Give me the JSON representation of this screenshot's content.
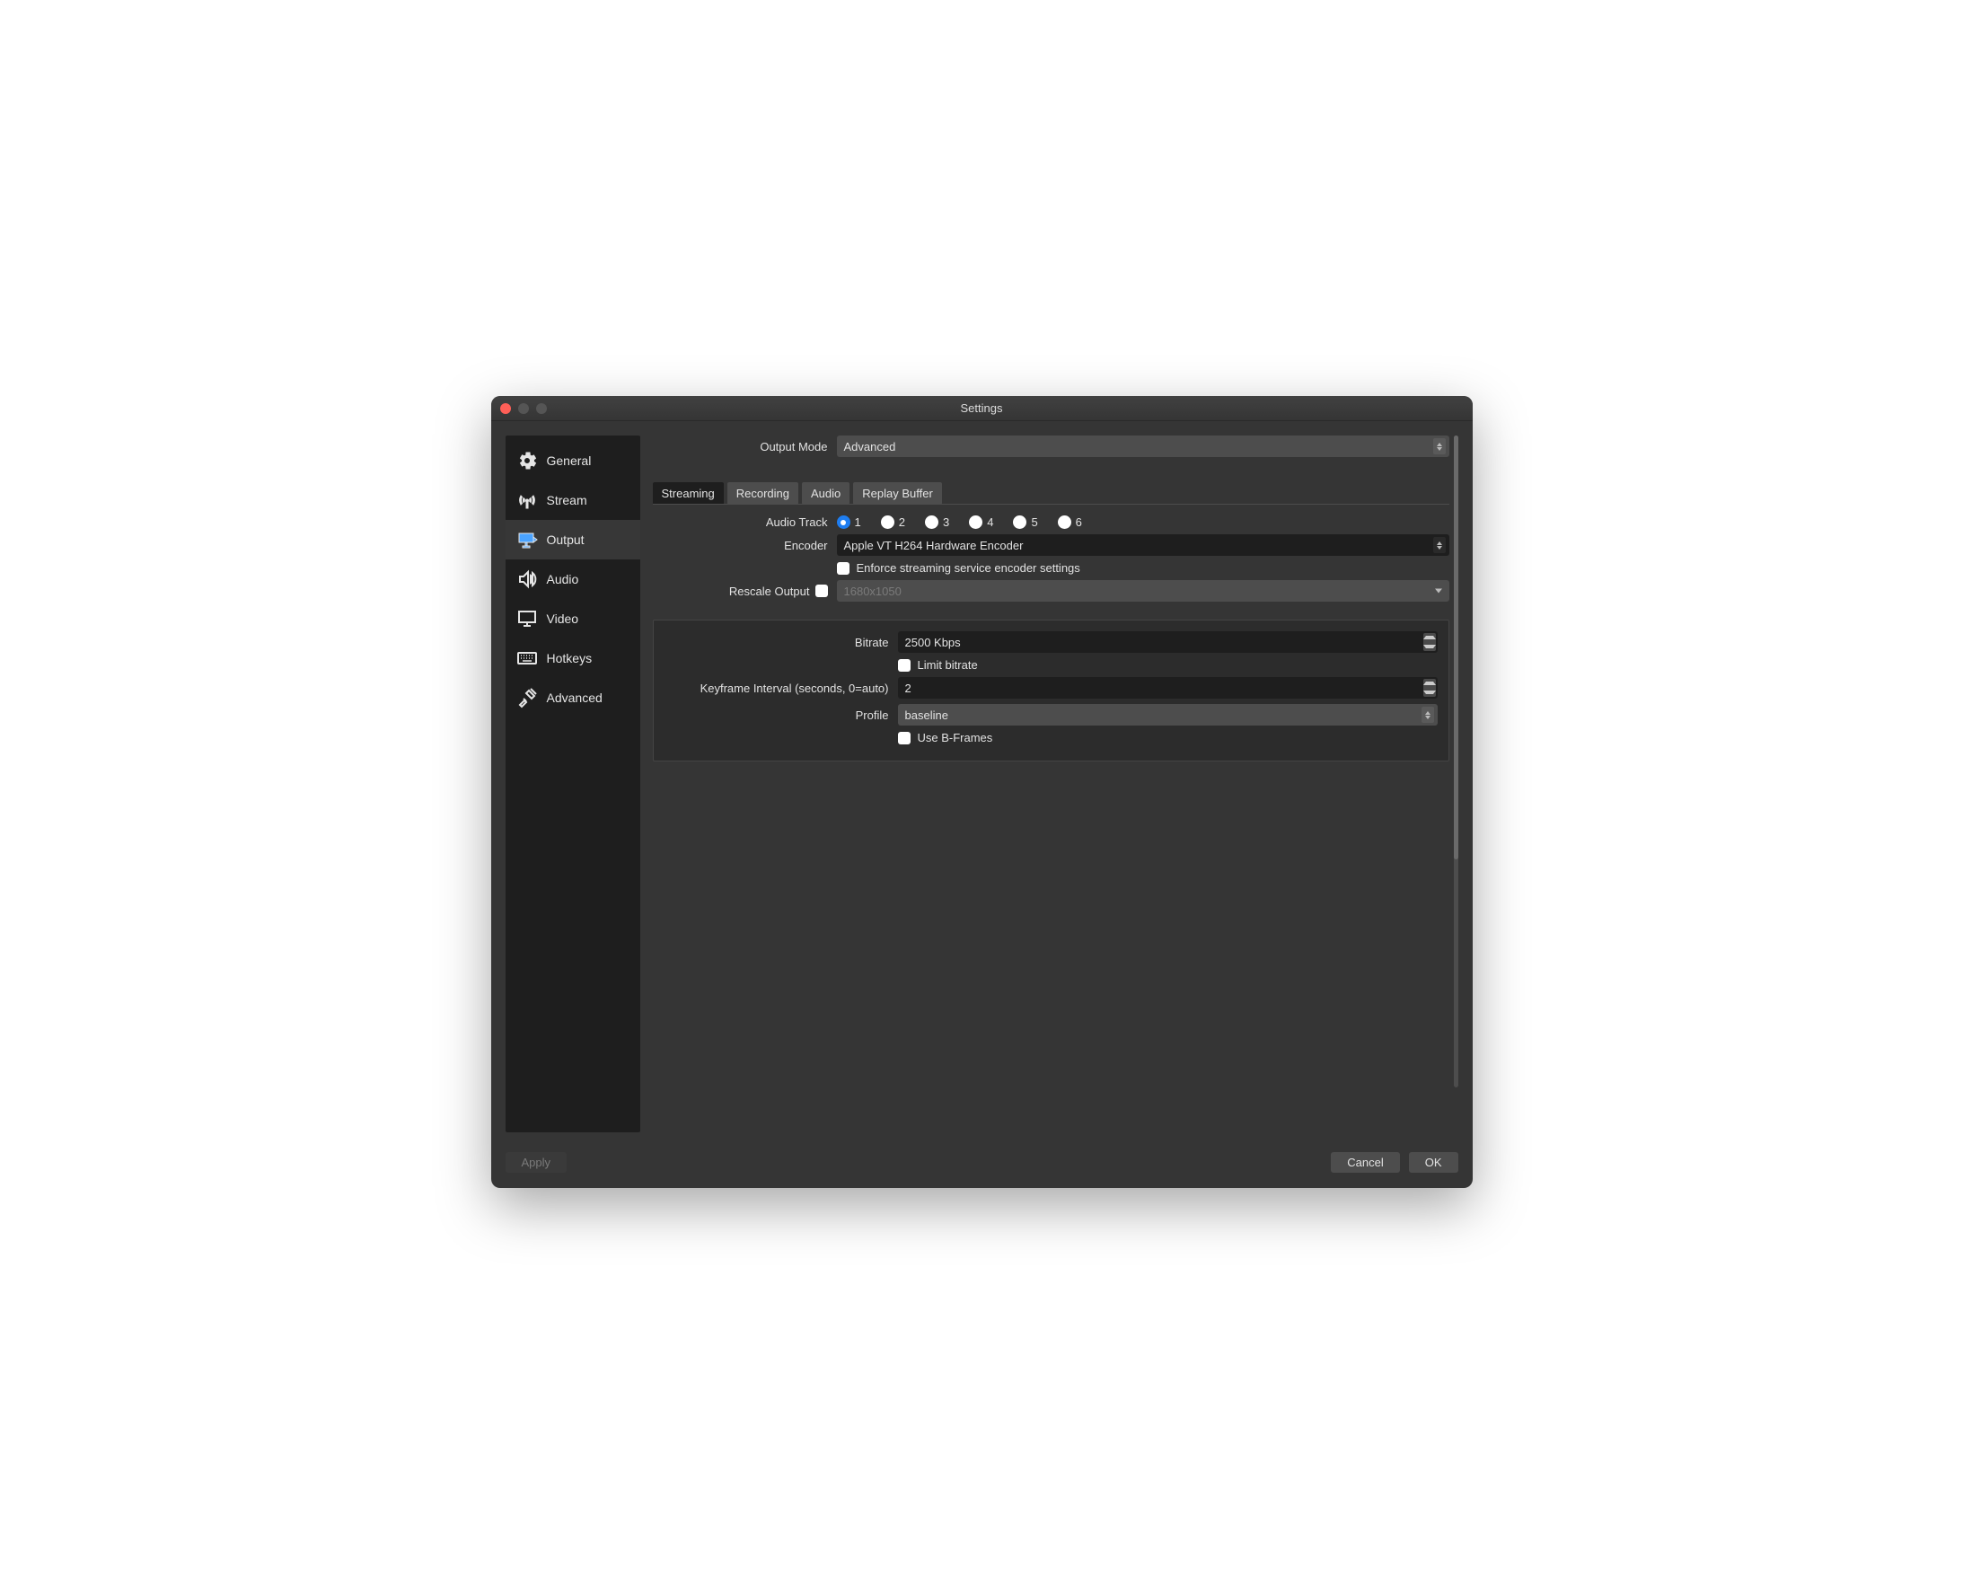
{
  "window": {
    "title": "Settings"
  },
  "sidebar": {
    "items": [
      {
        "label": "General"
      },
      {
        "label": "Stream"
      },
      {
        "label": "Output"
      },
      {
        "label": "Audio"
      },
      {
        "label": "Video"
      },
      {
        "label": "Hotkeys"
      },
      {
        "label": "Advanced"
      }
    ],
    "active_index": 2
  },
  "output_mode": {
    "label": "Output Mode",
    "value": "Advanced"
  },
  "tabs": {
    "items": [
      {
        "label": "Streaming"
      },
      {
        "label": "Recording"
      },
      {
        "label": "Audio"
      },
      {
        "label": "Replay Buffer"
      }
    ],
    "active_index": 0
  },
  "audio_track": {
    "label": "Audio Track",
    "options": [
      "1",
      "2",
      "3",
      "4",
      "5",
      "6"
    ],
    "selected": "1"
  },
  "encoder": {
    "label": "Encoder",
    "value": "Apple VT H264 Hardware Encoder",
    "enforce_label": "Enforce streaming service encoder settings",
    "enforce_checked": false
  },
  "rescale": {
    "label": "Rescale Output",
    "checked": false,
    "placeholder": "1680x1050"
  },
  "bitrate": {
    "label": "Bitrate",
    "value": "2500 Kbps",
    "limit_label": "Limit bitrate",
    "limit_checked": false
  },
  "keyframe": {
    "label": "Keyframe Interval (seconds, 0=auto)",
    "value": "2"
  },
  "profile": {
    "label": "Profile",
    "value": "baseline",
    "bframes_label": "Use B-Frames",
    "bframes_checked": false
  },
  "buttons": {
    "apply": "Apply",
    "cancel": "Cancel",
    "ok": "OK"
  }
}
